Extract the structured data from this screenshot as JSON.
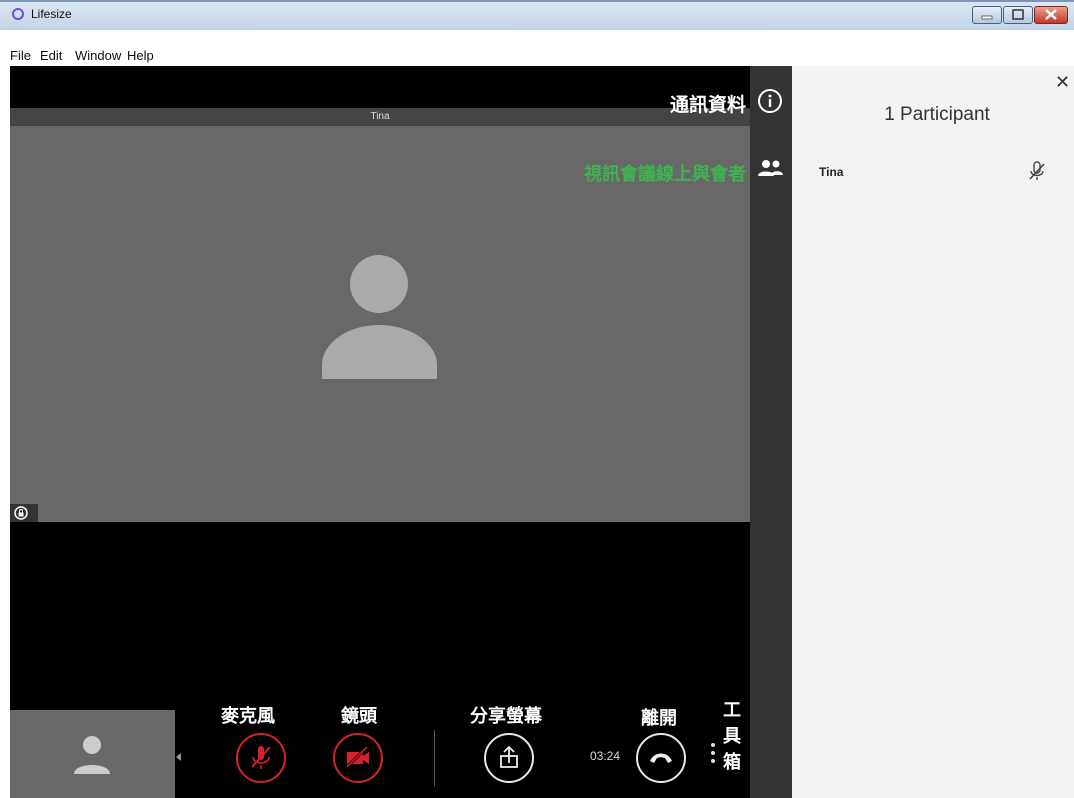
{
  "window": {
    "title": "Lifesize"
  },
  "menu": [
    "File",
    "Edit",
    "Window",
    "Help"
  ],
  "video": {
    "participant_name": "Tina"
  },
  "side_rail": {
    "info_label": "通訊資料",
    "participants_label": "視訊會議線上與會者"
  },
  "panel": {
    "title": "1 Participant",
    "participants": [
      {
        "name": "Tina",
        "muted": true
      }
    ]
  },
  "controls": {
    "mic_label": "麥克風",
    "camera_label": "鏡頭",
    "share_label": "分享螢幕",
    "leave_label": "離開",
    "toolbox_label": [
      "工",
      "具",
      "箱"
    ],
    "timer": "03:24"
  },
  "colors": {
    "mute_red": "#d4232c",
    "highlight_green": "#3fb44f",
    "video_gray": "#686868",
    "panel_bg": "#f3f3f3"
  }
}
